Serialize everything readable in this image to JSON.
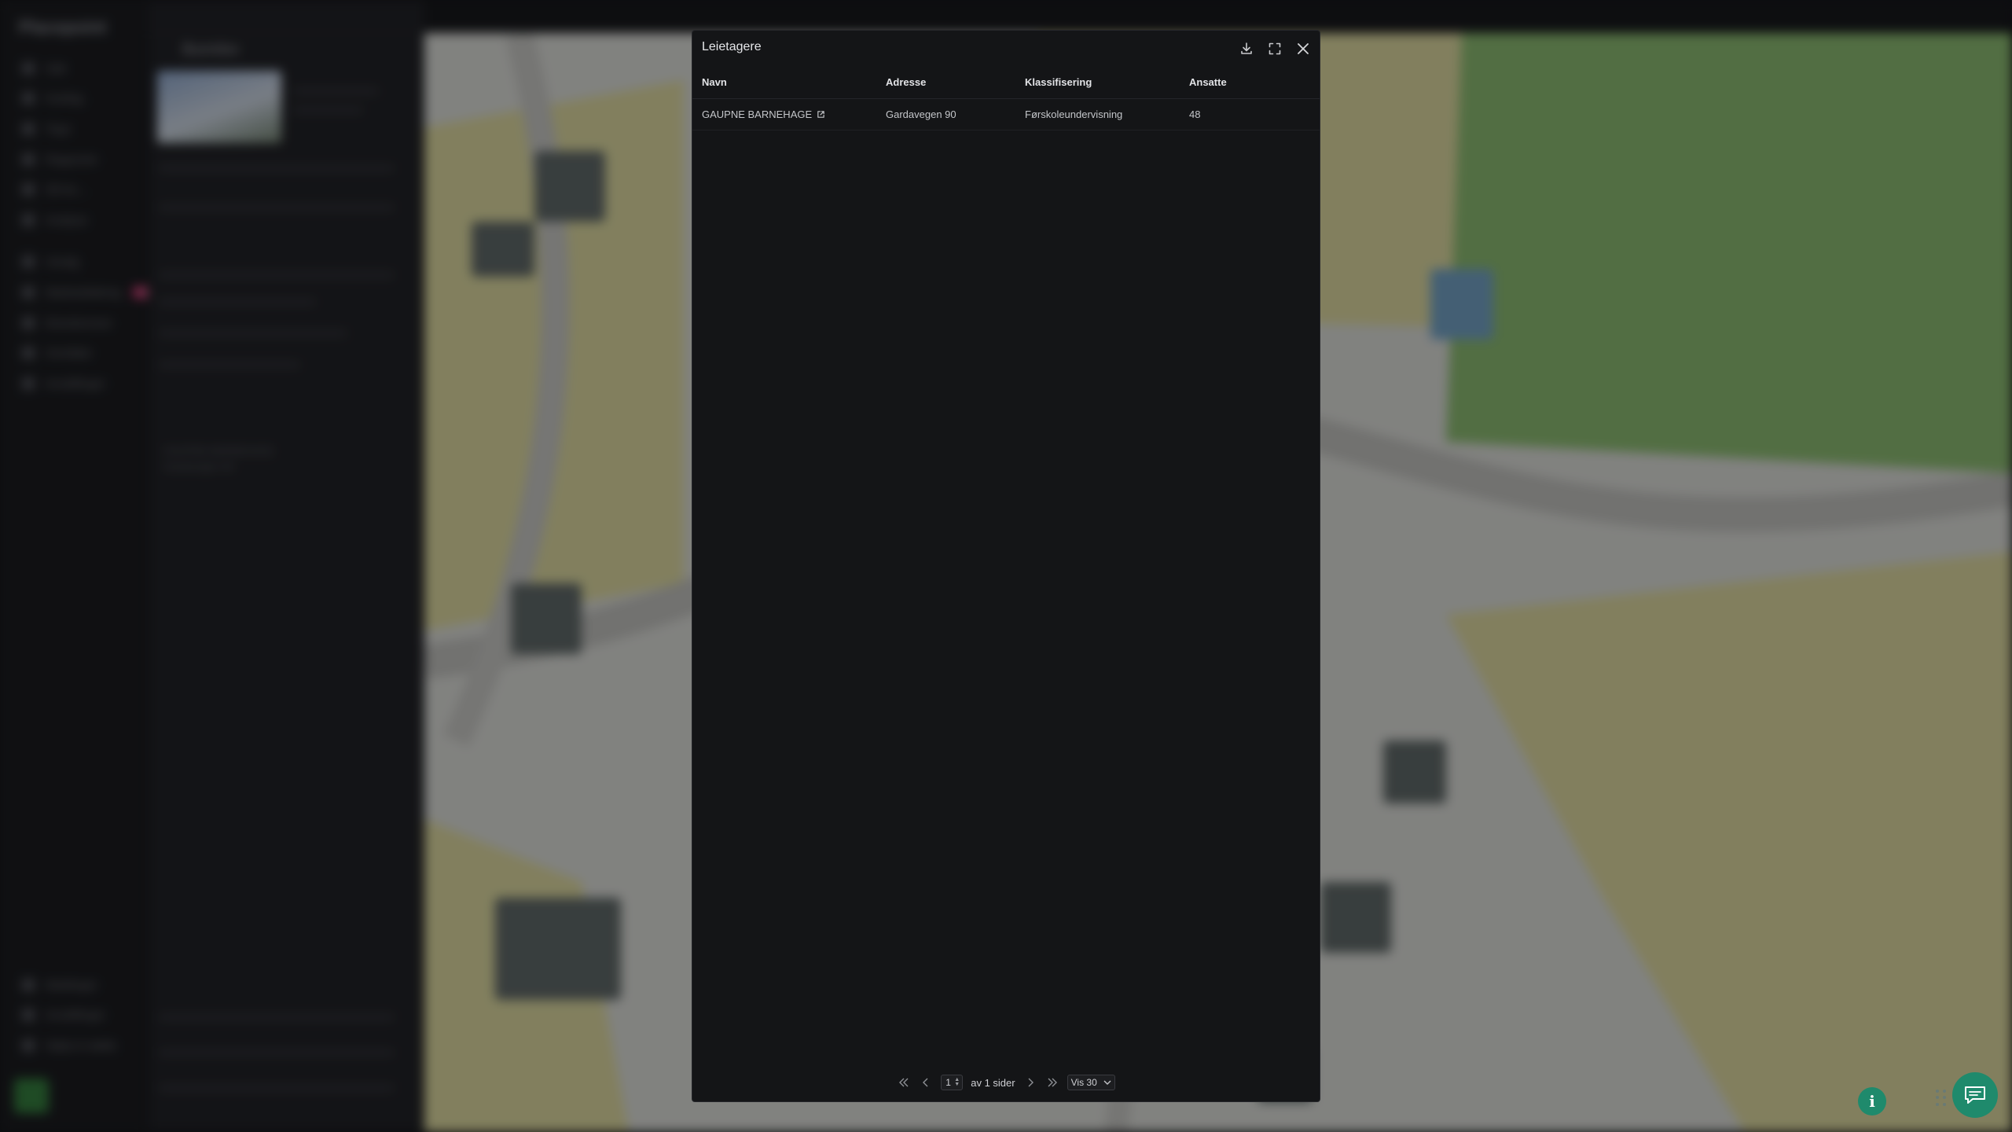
{
  "background": {
    "app_name": "Placepoint",
    "sidebar_items": [
      "Søk",
      "Kartlag",
      "Tegn",
      "Rapporter",
      "3D-ko…",
      "Analyse",
      "Utvalg",
      "Markedsføring",
      "Eiendommer",
      "Områder",
      "Innstillinger"
    ],
    "sidebar_badge": "Ny",
    "sidebar_bottom": [
      "Meldinger",
      "Innstillinger",
      "Hjelp & støtte"
    ],
    "panel_title": "Bunnlov",
    "panel_hints": [
      "GAUPNE BARNEHAGE",
      "Gardavegen 90"
    ]
  },
  "modal": {
    "title": "Leietagere",
    "actions": [
      {
        "name": "download-icon",
        "label": "Last ned"
      },
      {
        "name": "fullscreen-icon",
        "label": "Fullskjerm"
      },
      {
        "name": "close-icon",
        "label": "Lukk"
      }
    ],
    "columns": [
      "Navn",
      "Adresse",
      "Klassifisering",
      "Ansatte"
    ],
    "rows": [
      {
        "name": "GAUPNE BARNEHAGE",
        "address": "Gardavegen 90",
        "classification": "Førskoleundervisning",
        "employees": "48"
      }
    ],
    "pagination": {
      "current_page": "1",
      "total_text": "av 1 sider",
      "per_page": "Vis 30"
    }
  },
  "widgets": {
    "info_label": "i",
    "accent": "#1f8a6c"
  }
}
